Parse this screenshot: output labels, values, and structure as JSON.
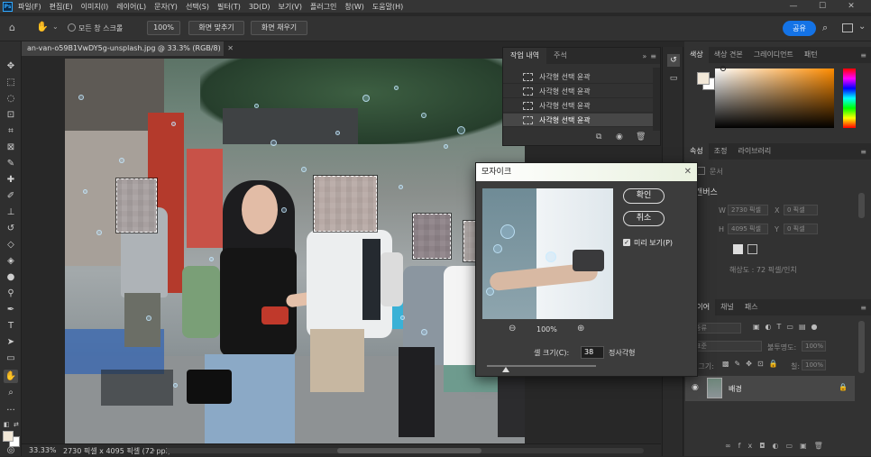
{
  "app": {
    "logo": "Ps"
  },
  "menubar": {
    "items": [
      "파일(F)",
      "편집(E)",
      "이미지(I)",
      "레이어(L)",
      "문자(Y)",
      "선택(S)",
      "필터(T)",
      "3D(D)",
      "보기(V)",
      "플러그인",
      "창(W)",
      "도움말(H)"
    ]
  },
  "options": {
    "scroll_all_label": "모든 창 스크롤",
    "zoom_value": "100%",
    "fit_screen_label": "화면 맞추기",
    "fill_screen_label": "화면 채우기",
    "share_label": "공유"
  },
  "document": {
    "tab_title": "an-van-o59B1VwDY5g-unsplash.jpg @ 33.3% (RGB/8)",
    "zoom_status": "33.33%",
    "size_status": "2730 픽셀 x 4095 픽셀 (72 ppi)"
  },
  "history": {
    "tabs": [
      "작업 내역",
      "주석"
    ],
    "rows": [
      "사각형 선택 윤곽",
      "사각형 선택 윤곽",
      "사각형 선택 윤곽",
      "사각형 선택 윤곽"
    ]
  },
  "right": {
    "color_tabs": [
      "색상",
      "색상 견본",
      "그레이디언트",
      "패턴"
    ],
    "prop_tabs": [
      "속성",
      "조정",
      "라이브러리"
    ],
    "prop_doc_label": "문서",
    "canvas_label": "캔버스",
    "w_label": "W",
    "w_value": "2730 픽셀",
    "h_label": "H",
    "h_value": "4095 픽셀",
    "x_label": "X",
    "x_value": "0 픽셀",
    "y_label": "Y",
    "y_value": "0 픽셀",
    "resolution": "해상도 : 72 픽셀/인치",
    "layer_tabs": [
      "레이어",
      "채널",
      "패스"
    ],
    "layer_kind": "종류",
    "blend_mode": "표준",
    "opacity_label": "불투명도:",
    "opacity_value": "100%",
    "lock_label": "잠그기:",
    "fill_label": "칠:",
    "fill_value": "100%",
    "layer_name": "배경"
  },
  "dialog": {
    "title": "모자이크",
    "ok_label": "확인",
    "cancel_label": "취소",
    "preview_label": "미리 보기(P)",
    "preview_checked": true,
    "zoom_value": "100%",
    "cell_size_label": "셀 크기(C):",
    "cell_size_value": "38",
    "cell_unit": "정사각형",
    "cell_size_slider_fraction": 0.17
  },
  "colors": {
    "accent": "#1473e6",
    "foreground": "#f2e8d8",
    "background": "#ffffff",
    "picker_hue": "#ff8c00"
  }
}
